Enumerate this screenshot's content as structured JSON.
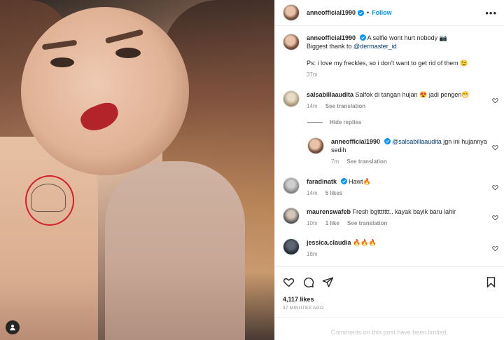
{
  "post": {
    "username": "anneofficial1990",
    "follow_label": "Follow",
    "separator": "•",
    "more_label": "•••"
  },
  "caption": {
    "username": "anneofficial1990",
    "text1": "A selfie wont hurt nobody 📷",
    "text2_prefix": "Biggest thank to ",
    "mention": "@dermaster_id",
    "text3": "Ps: i love my freckles, so i don't want to get rid of them 😉",
    "time": "37m"
  },
  "comments": [
    {
      "username": "salsabillaaudita",
      "text": "Salfok di tangan hujan 😍 jadi pengen😁",
      "time": "14m",
      "likes": "",
      "translate": "See translation"
    },
    {
      "username": "faradinatk",
      "text": "Hawt🔥",
      "time": "14m",
      "likes": "5 likes",
      "translate": ""
    },
    {
      "username": "maurenswafeb",
      "text": "Fresh bgttttttt.. kayak bayik baru lahir",
      "time": "10m",
      "likes": "1 like",
      "translate": "See translation"
    },
    {
      "username": "jessica.claudia",
      "text": "🔥🔥🔥",
      "time": "18m",
      "likes": "",
      "translate": ""
    }
  ],
  "hide_replies": "Hide replies",
  "reply": {
    "username": "anneofficial1990",
    "mention": "@salsabillaaudita",
    "text": " jgn ini hujannya sedih",
    "time": "7m",
    "translate": "See translation"
  },
  "footer": {
    "likes": "4,117 likes",
    "time_ago": "37 MINUTES AGO",
    "limited": "Comments on this post have been limited."
  },
  "colors": {
    "accent": "#0095f6",
    "verified": "#0095f6",
    "muted": "#8e8e8e"
  }
}
